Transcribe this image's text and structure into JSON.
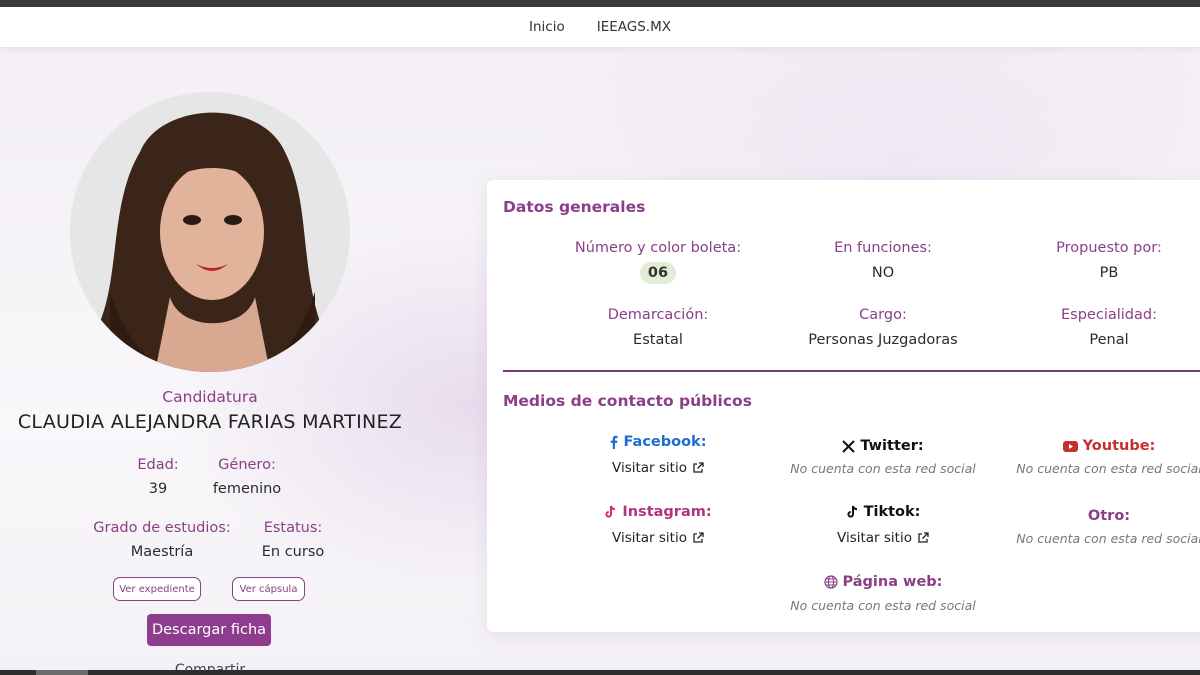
{
  "nav": {
    "items": [
      "Inicio",
      "IEEAGS.MX"
    ]
  },
  "profile": {
    "role_label": "Candidatura",
    "name": "CLAUDIA ALEJANDRA FARIAS MARTINEZ",
    "age_label": "Edad:",
    "age": "39",
    "gender_label": "Género:",
    "gender": "femenino",
    "education_label": "Grado de estudios:",
    "education": "Maestría",
    "status_label": "Estatus:",
    "status": "En curso",
    "view_file_label": "Ver expediente",
    "view_capsule_label": "Ver cápsula",
    "download_label": "Descargar ficha",
    "share_label": "Compartir"
  },
  "general": {
    "title": "Datos generales",
    "ballot_label": "Número y color boleta:",
    "ballot_number": "06",
    "ballot_color": "#e3ecd5",
    "in_office_label": "En funciones:",
    "in_office": "NO",
    "proposed_label": "Propuesto por:",
    "proposed": "PB",
    "demarcation_label": "Demarcación:",
    "demarcation": "Estatal",
    "position_label": "Cargo:",
    "position": "Personas Juzgadoras",
    "specialty_label": "Especialidad:",
    "specialty": "Penal"
  },
  "contact": {
    "title": "Medios de contacto públicos",
    "visit_label": "Visitar sitio",
    "no_account": "No cuenta con esta red social",
    "facebook": {
      "label": "Facebook:",
      "icon": "facebook-icon",
      "color": "#1c6fd1"
    },
    "twitter": {
      "label": "Twitter:",
      "icon": "x-icon",
      "color": "#111111"
    },
    "youtube": {
      "label": "Youtube:",
      "icon": "youtube-icon",
      "color": "#c4302b"
    },
    "instagram": {
      "label": "Instagram:",
      "icon": "instagram-icon",
      "color": "#b0357f"
    },
    "tiktok": {
      "label": "Tiktok:",
      "icon": "tiktok-icon",
      "color": "#111111"
    },
    "other": {
      "label": "Otro:",
      "color": "#8a3f86"
    },
    "web": {
      "label": "Página web:",
      "icon": "globe-icon",
      "color": "#8a3f86"
    }
  },
  "colors": {
    "accent": "#8a3f86",
    "button": "#8e3d8e"
  }
}
